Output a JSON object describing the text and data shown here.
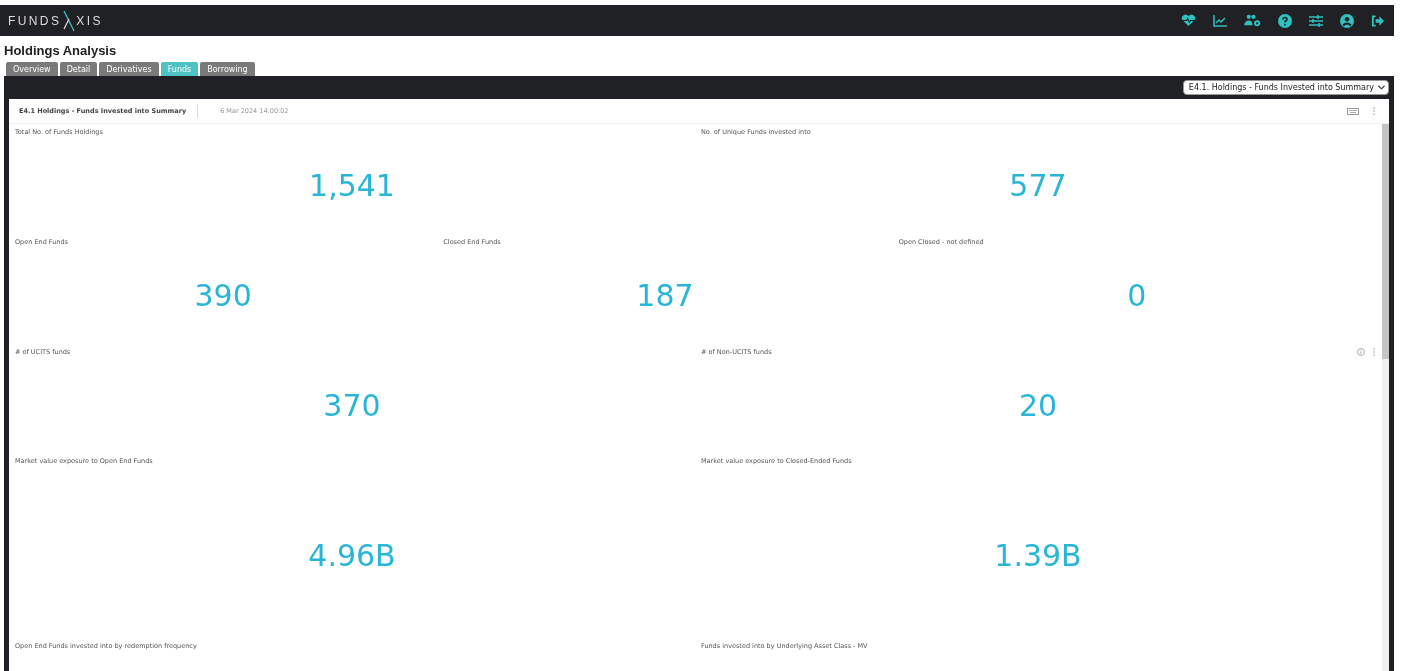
{
  "header": {
    "logo": "FUNDS",
    "logo_b": "XIS"
  },
  "page_title": "Holdings Analysis",
  "tabs": [
    {
      "label": "Overview",
      "selected": false
    },
    {
      "label": "Detail",
      "selected": false
    },
    {
      "label": "Derivatives",
      "selected": false
    },
    {
      "label": "Funds",
      "selected": true
    },
    {
      "label": "Borrowing",
      "selected": false
    }
  ],
  "report_select": {
    "value": "E4.1. Holdings - Funds Invested into Summary"
  },
  "card": {
    "title": "E4.1 Holdings - Funds Invested into Summary",
    "timestamp": "6 Mar 2024 14:00:02"
  },
  "tile_rows": [
    {
      "tiles": [
        {
          "label": "Total No. of Funds Holdings",
          "value": "1,541",
          "info": false
        },
        {
          "label": "No. of Unique Funds invested into",
          "value": "577",
          "info": false
        }
      ]
    },
    {
      "tiles": [
        {
          "label": "Open End Funds",
          "value": "390",
          "info": false
        },
        {
          "label": "Closed End Funds",
          "value": "187",
          "info": false
        },
        {
          "label": "Open Closed - not defined",
          "value": "0",
          "info": false
        }
      ]
    },
    {
      "tiles": [
        {
          "label": "# of UCITS funds",
          "value": "370",
          "info": false
        },
        {
          "label": "# of Non-UCITS funds",
          "value": "20",
          "info": true
        }
      ]
    },
    {
      "tiles": [
        {
          "label": "Market value exposure to Open End Funds",
          "value": "4.96B",
          "info": false
        },
        {
          "label": "Market value exposure to Closed-Ended Funds",
          "value": "1.39B",
          "info": false
        }
      ]
    },
    {
      "tiles": [
        {
          "label": "Open End Funds invested into by redemption frequency"
        },
        {
          "label": "Funds invested into by Underlying Asset Class - MV"
        }
      ]
    }
  ]
}
